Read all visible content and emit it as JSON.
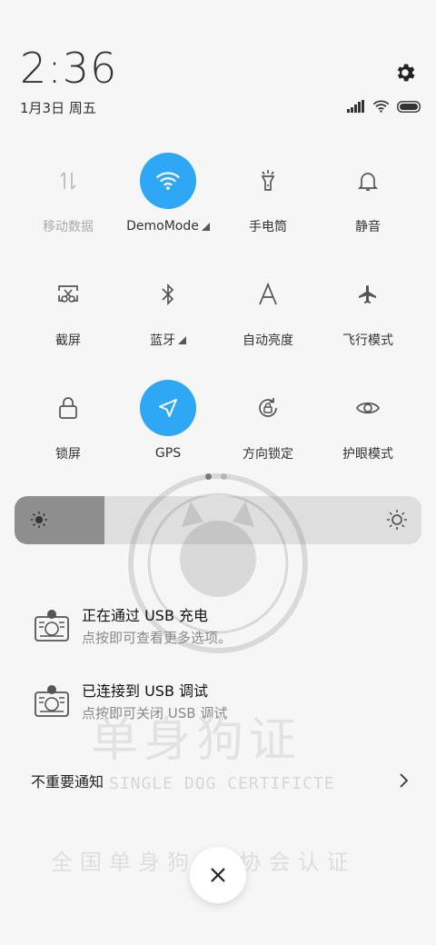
{
  "status": {
    "time": "2:36",
    "date": "1月3日 周五"
  },
  "tiles": [
    {
      "label": "移动数据",
      "icon": "mobile-data-icon",
      "active": false,
      "dim": true
    },
    {
      "label": "DemoMode",
      "icon": "wifi-icon",
      "active": true,
      "more": true
    },
    {
      "label": "手电筒",
      "icon": "flashlight-icon",
      "active": false
    },
    {
      "label": "静音",
      "icon": "bell-icon",
      "active": false
    },
    {
      "label": "截屏",
      "icon": "screenshot-icon",
      "active": false
    },
    {
      "label": "蓝牙",
      "icon": "bluetooth-icon",
      "active": false,
      "more": true
    },
    {
      "label": "自动亮度",
      "icon": "auto-brightness-icon",
      "active": false
    },
    {
      "label": "飞行模式",
      "icon": "airplane-icon",
      "active": false
    },
    {
      "label": "锁屏",
      "icon": "lock-icon",
      "active": false
    },
    {
      "label": "GPS",
      "icon": "gps-icon",
      "active": true
    },
    {
      "label": "方向锁定",
      "icon": "rotation-lock-icon",
      "active": false
    },
    {
      "label": "护眼模式",
      "icon": "eye-icon",
      "active": false
    }
  ],
  "brightness": {
    "level": 0.22
  },
  "notifications": [
    {
      "title": "正在通过 USB 充电",
      "subtitle": "点按即可查看更多选项。"
    },
    {
      "title": "已连接到 USB 调试",
      "subtitle": "点按即可关闭 USB 调试"
    }
  ],
  "unimportant": {
    "label": "不重要通知"
  },
  "watermark": {
    "title": "单身狗证",
    "subtitle": "SINGLE DOG CERTIFICTE",
    "bottom": "全国单身狗  证协会认证"
  },
  "colors": {
    "accent": "#2ea8f5",
    "icon": "#555555"
  }
}
